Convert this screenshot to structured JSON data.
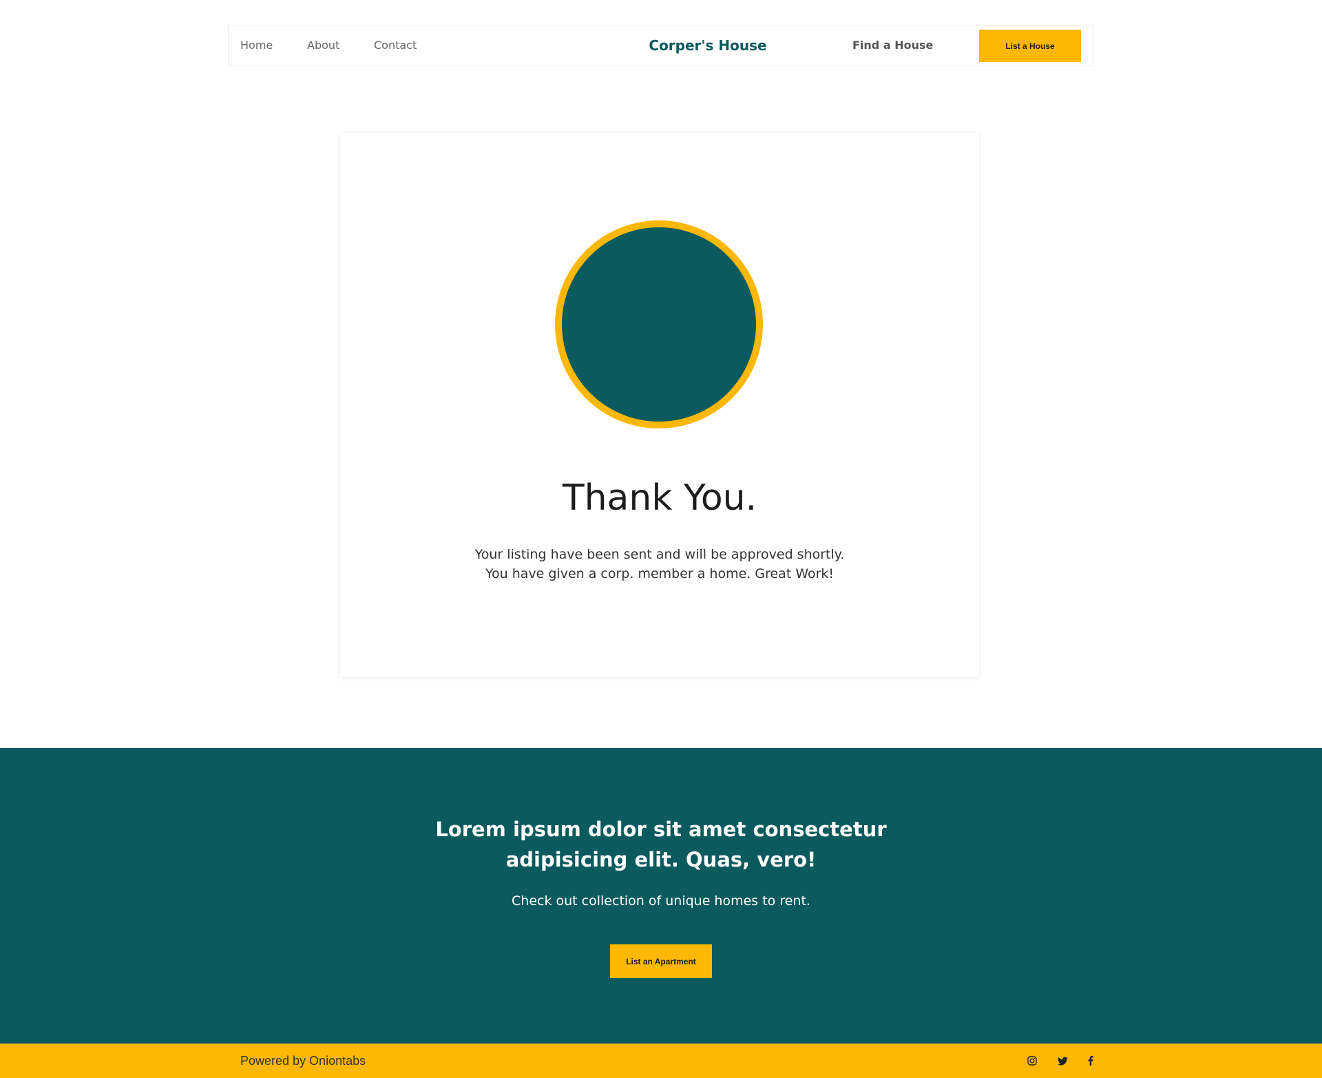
{
  "nav": {
    "home": "Home",
    "about": "About",
    "contact": "Contact",
    "brand": "Corper's House",
    "find": "Find a House",
    "list_button": "List a House"
  },
  "card": {
    "title": "Thank You.",
    "message_line1": "Your listing have been sent and will be approved shortly.",
    "message_line2": "You have given a corp. member a home. Great Work!"
  },
  "cta": {
    "title_line1": "Lorem ipsum dolor sit amet consectetur",
    "title_line2": "adipisicing elit. Quas, vero!",
    "subtitle": "Check out collection of unique homes to rent.",
    "button": "List an Apartment"
  },
  "footer": {
    "powered": "Powered by Oniontabs",
    "icons": [
      "instagram-icon",
      "twitter-icon",
      "facebook-icon"
    ]
  },
  "colors": {
    "primary": "#0a5a5e",
    "accent": "#fdb705"
  }
}
